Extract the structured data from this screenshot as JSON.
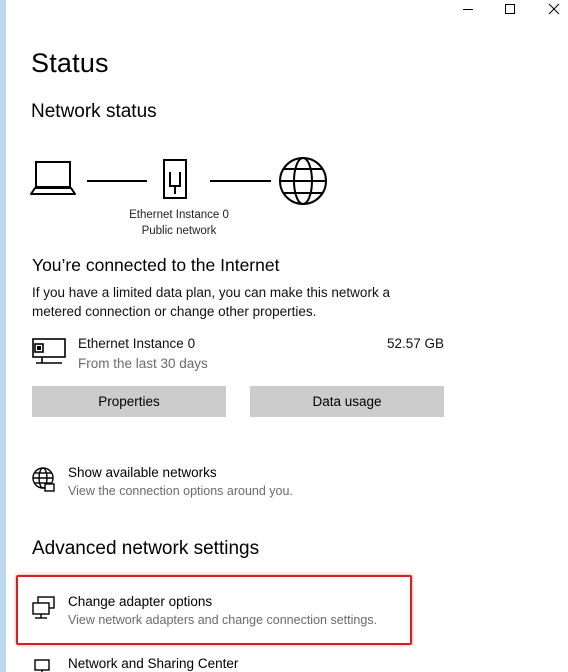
{
  "window": {
    "controls": {
      "minimize_icon": "minimize-icon",
      "maximize_icon": "maximize-icon",
      "close_icon": "close-icon"
    }
  },
  "page": {
    "title": "Status"
  },
  "network_status": {
    "heading": "Network status",
    "diagram": {
      "computer_icon": "laptop-icon",
      "adapter_icon": "ethernet-port-icon",
      "internet_icon": "globe-icon",
      "adapter_name": "Ethernet Instance 0",
      "network_type": "Public network"
    },
    "connected_title": "You’re connected to the Internet",
    "connected_desc": "If you have a limited data plan, you can make this network a metered connection or change other properties.",
    "adapter": {
      "icon": "ethernet-adapter-icon",
      "name": "Ethernet Instance 0",
      "period": "From the last 30 days",
      "usage": "52.57 GB"
    },
    "buttons": {
      "properties": "Properties",
      "data_usage": "Data usage"
    },
    "show_networks": {
      "icon": "globe-network-icon",
      "title": "Show available networks",
      "desc": "View the connection options around you."
    }
  },
  "advanced": {
    "heading": "Advanced network settings",
    "change_adapter": {
      "icon": "network-adapters-icon",
      "title": "Change adapter options",
      "desc": "View network adapters and change connection settings."
    },
    "sharing_center": {
      "icon": "sharing-center-icon",
      "title": "Network and Sharing Center"
    }
  },
  "colors": {
    "accent_strip": "#bcd7ef",
    "button_bg": "#cccccc",
    "highlight": "#d32027",
    "secondary_text": "#6b6b6b"
  }
}
